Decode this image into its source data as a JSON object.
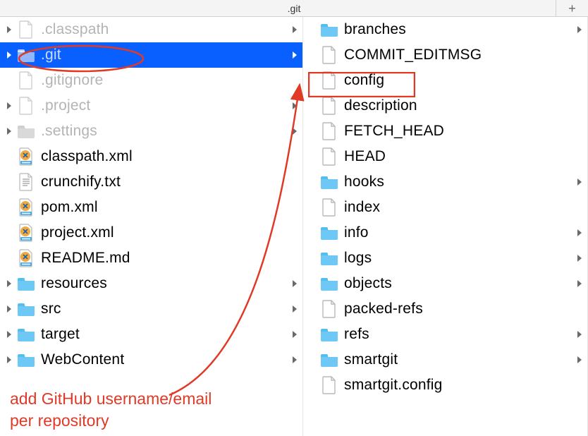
{
  "header": {
    "title": ".git",
    "add_tab_label": "+"
  },
  "left": {
    "items": [
      {
        "name": ".classpath",
        "icon": "file",
        "dimmed": true,
        "expandable": true,
        "selected": false
      },
      {
        "name": ".git",
        "icon": "folder",
        "dimmed": true,
        "expandable": true,
        "selected": true
      },
      {
        "name": ".gitignore",
        "icon": "file",
        "dimmed": true,
        "expandable": false,
        "selected": false
      },
      {
        "name": ".project",
        "icon": "file",
        "dimmed": true,
        "expandable": true,
        "selected": false
      },
      {
        "name": ".settings",
        "icon": "folder",
        "dimmed": true,
        "expandable": true,
        "selected": false
      },
      {
        "name": "classpath.xml",
        "icon": "xml",
        "dimmed": false,
        "expandable": false,
        "selected": false
      },
      {
        "name": "crunchify.txt",
        "icon": "text",
        "dimmed": false,
        "expandable": false,
        "selected": false
      },
      {
        "name": "pom.xml",
        "icon": "xml",
        "dimmed": false,
        "expandable": false,
        "selected": false
      },
      {
        "name": "project.xml",
        "icon": "xml",
        "dimmed": false,
        "expandable": false,
        "selected": false
      },
      {
        "name": "README.md",
        "icon": "xml",
        "dimmed": false,
        "expandable": false,
        "selected": false
      },
      {
        "name": "resources",
        "icon": "folder",
        "dimmed": false,
        "expandable": true,
        "selected": false
      },
      {
        "name": "src",
        "icon": "folder",
        "dimmed": false,
        "expandable": true,
        "selected": false
      },
      {
        "name": "target",
        "icon": "folder",
        "dimmed": false,
        "expandable": true,
        "selected": false
      },
      {
        "name": "WebContent",
        "icon": "folder",
        "dimmed": false,
        "expandable": true,
        "selected": false
      }
    ]
  },
  "right": {
    "items": [
      {
        "name": "branches",
        "icon": "folder",
        "expandable": true
      },
      {
        "name": "COMMIT_EDITMSG",
        "icon": "file",
        "expandable": false
      },
      {
        "name": "config",
        "icon": "file",
        "expandable": false,
        "boxed": true
      },
      {
        "name": "description",
        "icon": "file",
        "expandable": false
      },
      {
        "name": "FETCH_HEAD",
        "icon": "file",
        "expandable": false
      },
      {
        "name": "HEAD",
        "icon": "file",
        "expandable": false
      },
      {
        "name": "hooks",
        "icon": "folder",
        "expandable": true
      },
      {
        "name": "index",
        "icon": "file",
        "expandable": false
      },
      {
        "name": "info",
        "icon": "folder",
        "expandable": true
      },
      {
        "name": "logs",
        "icon": "folder",
        "expandable": true
      },
      {
        "name": "objects",
        "icon": "folder",
        "expandable": true
      },
      {
        "name": "packed-refs",
        "icon": "file",
        "expandable": false
      },
      {
        "name": "refs",
        "icon": "folder",
        "expandable": true
      },
      {
        "name": "smartgit",
        "icon": "folder",
        "expandable": true
      },
      {
        "name": "smartgit.config",
        "icon": "file",
        "expandable": false
      }
    ]
  },
  "annotations": {
    "caption": "add GitHub username/email\nper repository",
    "circle_target": ".git",
    "arrow_target": "config"
  },
  "colors": {
    "annotation": "#e03a27",
    "selection": "#0a5fff",
    "folder": "#6ec8f5",
    "dimmed": "#b4b4b4"
  }
}
